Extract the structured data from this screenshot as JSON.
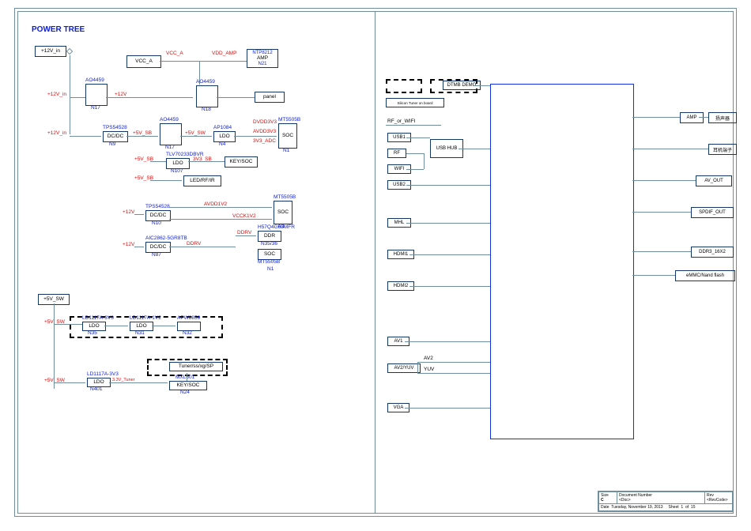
{
  "title": "POWER TREE",
  "left": {
    "in12": "+12V_in",
    "vcc_a_box": "VCC_A",
    "vcc_a": "VCC_A",
    "vdd_amp": "VDD_AMP",
    "amp_chip": "NTP8212",
    "amp_lbl": "AMP",
    "amp_ref": "N21",
    "ao4459": "AO4459",
    "n17": "N17",
    "n18": "N18",
    "panel": "panel",
    "tps54528": "TPS54528",
    "dcdc": "DC/DC",
    "n9": "N9",
    "n10": "N10",
    "plus12": "+12V",
    "plus12v_in": "+12V_in",
    "plus5sb": "+5V_SB",
    "plus5sw": "+5V_SW",
    "ap1084": "AP1084",
    "ldo": "LDO",
    "n4": "N4",
    "tlv70233": "TLV70233DBVR",
    "n107": "N107",
    "sb3v3": "3V3_SB",
    "keysoc": "KEY/SOC",
    "ledrfir": "LED/RF/IR",
    "dvdd3v3": "DVDD3V3",
    "avdd3v3": "AVDD3V3",
    "adc3v3": "3V3_ADC",
    "mt5505b": "MT5505B",
    "soc": "SOC",
    "n1": "N1",
    "avdd1v2": "AVDD1V2",
    "vcck1v2": "VCCK1V2",
    "ddrv": "DDRV",
    "aic2862": "AIC2862-5GR8TB",
    "n87": "N87",
    "h57q": "H57Q4G63MFR",
    "ddr": "DDR",
    "n35": "N35/36",
    "sw5_box": "+5V_SW",
    "ld1117_3v3": "LD1117A-3V3",
    "ld1117_1v2": "LD1117A-1V2",
    "apw8859": "APW8859",
    "n35b": "N35",
    "n31": "N31",
    "n32": "N32",
    "tuner_line": "Tuner/ss/xg/SP",
    "mxl601": "MXL601",
    "n401": "N401",
    "n24": "N24",
    "siltuner": "3.3V_Tuner"
  },
  "right": {
    "dtmb": "DTMB DEMO",
    "silicon": "Silicon Tuner on board",
    "rf_wifi": "RF_or_WIFI",
    "usb1": "USB1",
    "rf": "RF",
    "wifi": "WIFI",
    "usbhub": "USB HUB",
    "usb2": "USB2",
    "mhl": "MHL",
    "hdmi1": "HDMI1",
    "hdmi2": "HDMI2",
    "av1": "AV1",
    "av2": "AV2",
    "yuv": "YUV",
    "av2yuv": "AV2/YUV",
    "vga": "VGA",
    "amp": "AMP",
    "spk": "扬声器",
    "hpjack": "耳机端子",
    "avout": "AV_OUT",
    "spdif": "SPDIF_OUT",
    "ddr3": "DDR3_16X2",
    "emmc": "eMMC/Nand flash"
  },
  "titleblock": {
    "size": "Size",
    "sizev": "C",
    "docnum": "Document Number",
    "docv": "<Doc>",
    "rev": "Rev",
    "revv": "<RevCode>",
    "date": "Date",
    "datev": "Tuesday, November 19, 2013",
    "sheet": "Sheet",
    "sheetv": "1",
    "of": "of",
    "ofv": "15"
  }
}
